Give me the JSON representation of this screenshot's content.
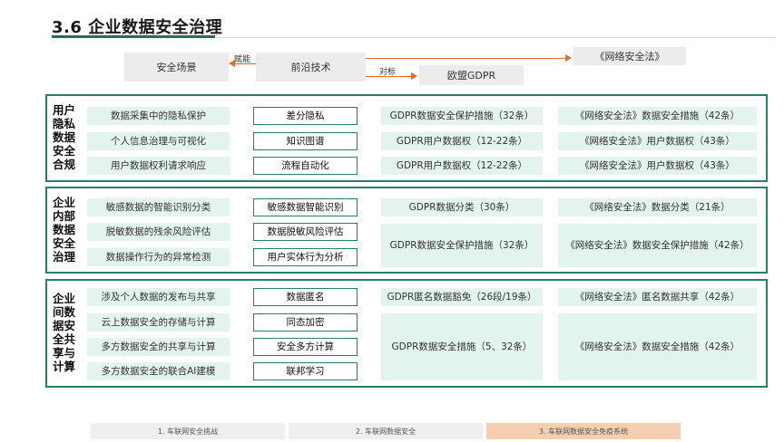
{
  "title": "3.6 企业数据安全治理",
  "top": {
    "scene": "安全场景",
    "enable_label": "赋能",
    "frontier": "前沿技术",
    "benchmark_label": "对标",
    "cyber_law": "《网络安全法》",
    "gdpr": "欧盟GDPR"
  },
  "sections": [
    {
      "label": "用户\n隐私\n数据\n安全\n合规",
      "scenes": [
        "数据采集中的隐私保护",
        "个人信息治理与可视化",
        "用户数据权利请求响应"
      ],
      "techs": [
        "差分隐私",
        "知识图谱",
        "流程自动化"
      ],
      "gdpr": [
        "GDPR数据安全保护措施（32条）",
        "GDPR用户数据权（12-22条）",
        "GDPR用户数据权（12-22条）"
      ],
      "law": [
        "《网络安全法》数据安全措施（42条）",
        "《网络安全法》用户数据权（43条）",
        "《网络安全法》用户数据权（43条）"
      ]
    },
    {
      "label": "企业\n内部\n数据\n安全\n治理",
      "scenes": [
        "敏感数据的智能识别分类",
        "脱敏数据的残余风险评估",
        "数据操作行为的异常检测"
      ],
      "techs": [
        "敏感数据智能识别",
        "数据脱敏风险评估",
        "用户实体行为分析"
      ],
      "gdpr": [
        "GDPR数据分类（30条）",
        "GDPR数据安全保护措施（32条）"
      ],
      "law": [
        "《网络安全法》数据分类（21条）",
        "《网络安全法》数据安全保护措施（42条）"
      ]
    },
    {
      "label": "企业\n间数\n据安\n全共\n享与\n计算",
      "scenes": [
        "涉及个人数据的发布与共享",
        "云上数据安全的存储与计算",
        "多方数据安全的共享与计算",
        "多方数据安全的联合AI建模"
      ],
      "techs": [
        "数据匿名",
        "同态加密",
        "安全多方计算",
        "联邦学习"
      ],
      "gdpr": [
        "GDPR匿名数据豁免（26段/19条）",
        "GDPR数据安全措施（5、32条）"
      ],
      "law": [
        "《网络安全法》匿名数据共享（42条）",
        "《网络安全法》数据安全措施（42条）"
      ]
    }
  ],
  "footer": {
    "tab1": "1. 车联网安全挑战",
    "tab2": "2. 车联网数据安全",
    "tab3": "3. 车联网数据安全免疫系统"
  },
  "colors": {
    "accent_green": "#2e7d6a",
    "cell_green": "#e3f3ee",
    "arrow_orange": "#e36c2c",
    "footer_active": "#f6cfb3"
  }
}
